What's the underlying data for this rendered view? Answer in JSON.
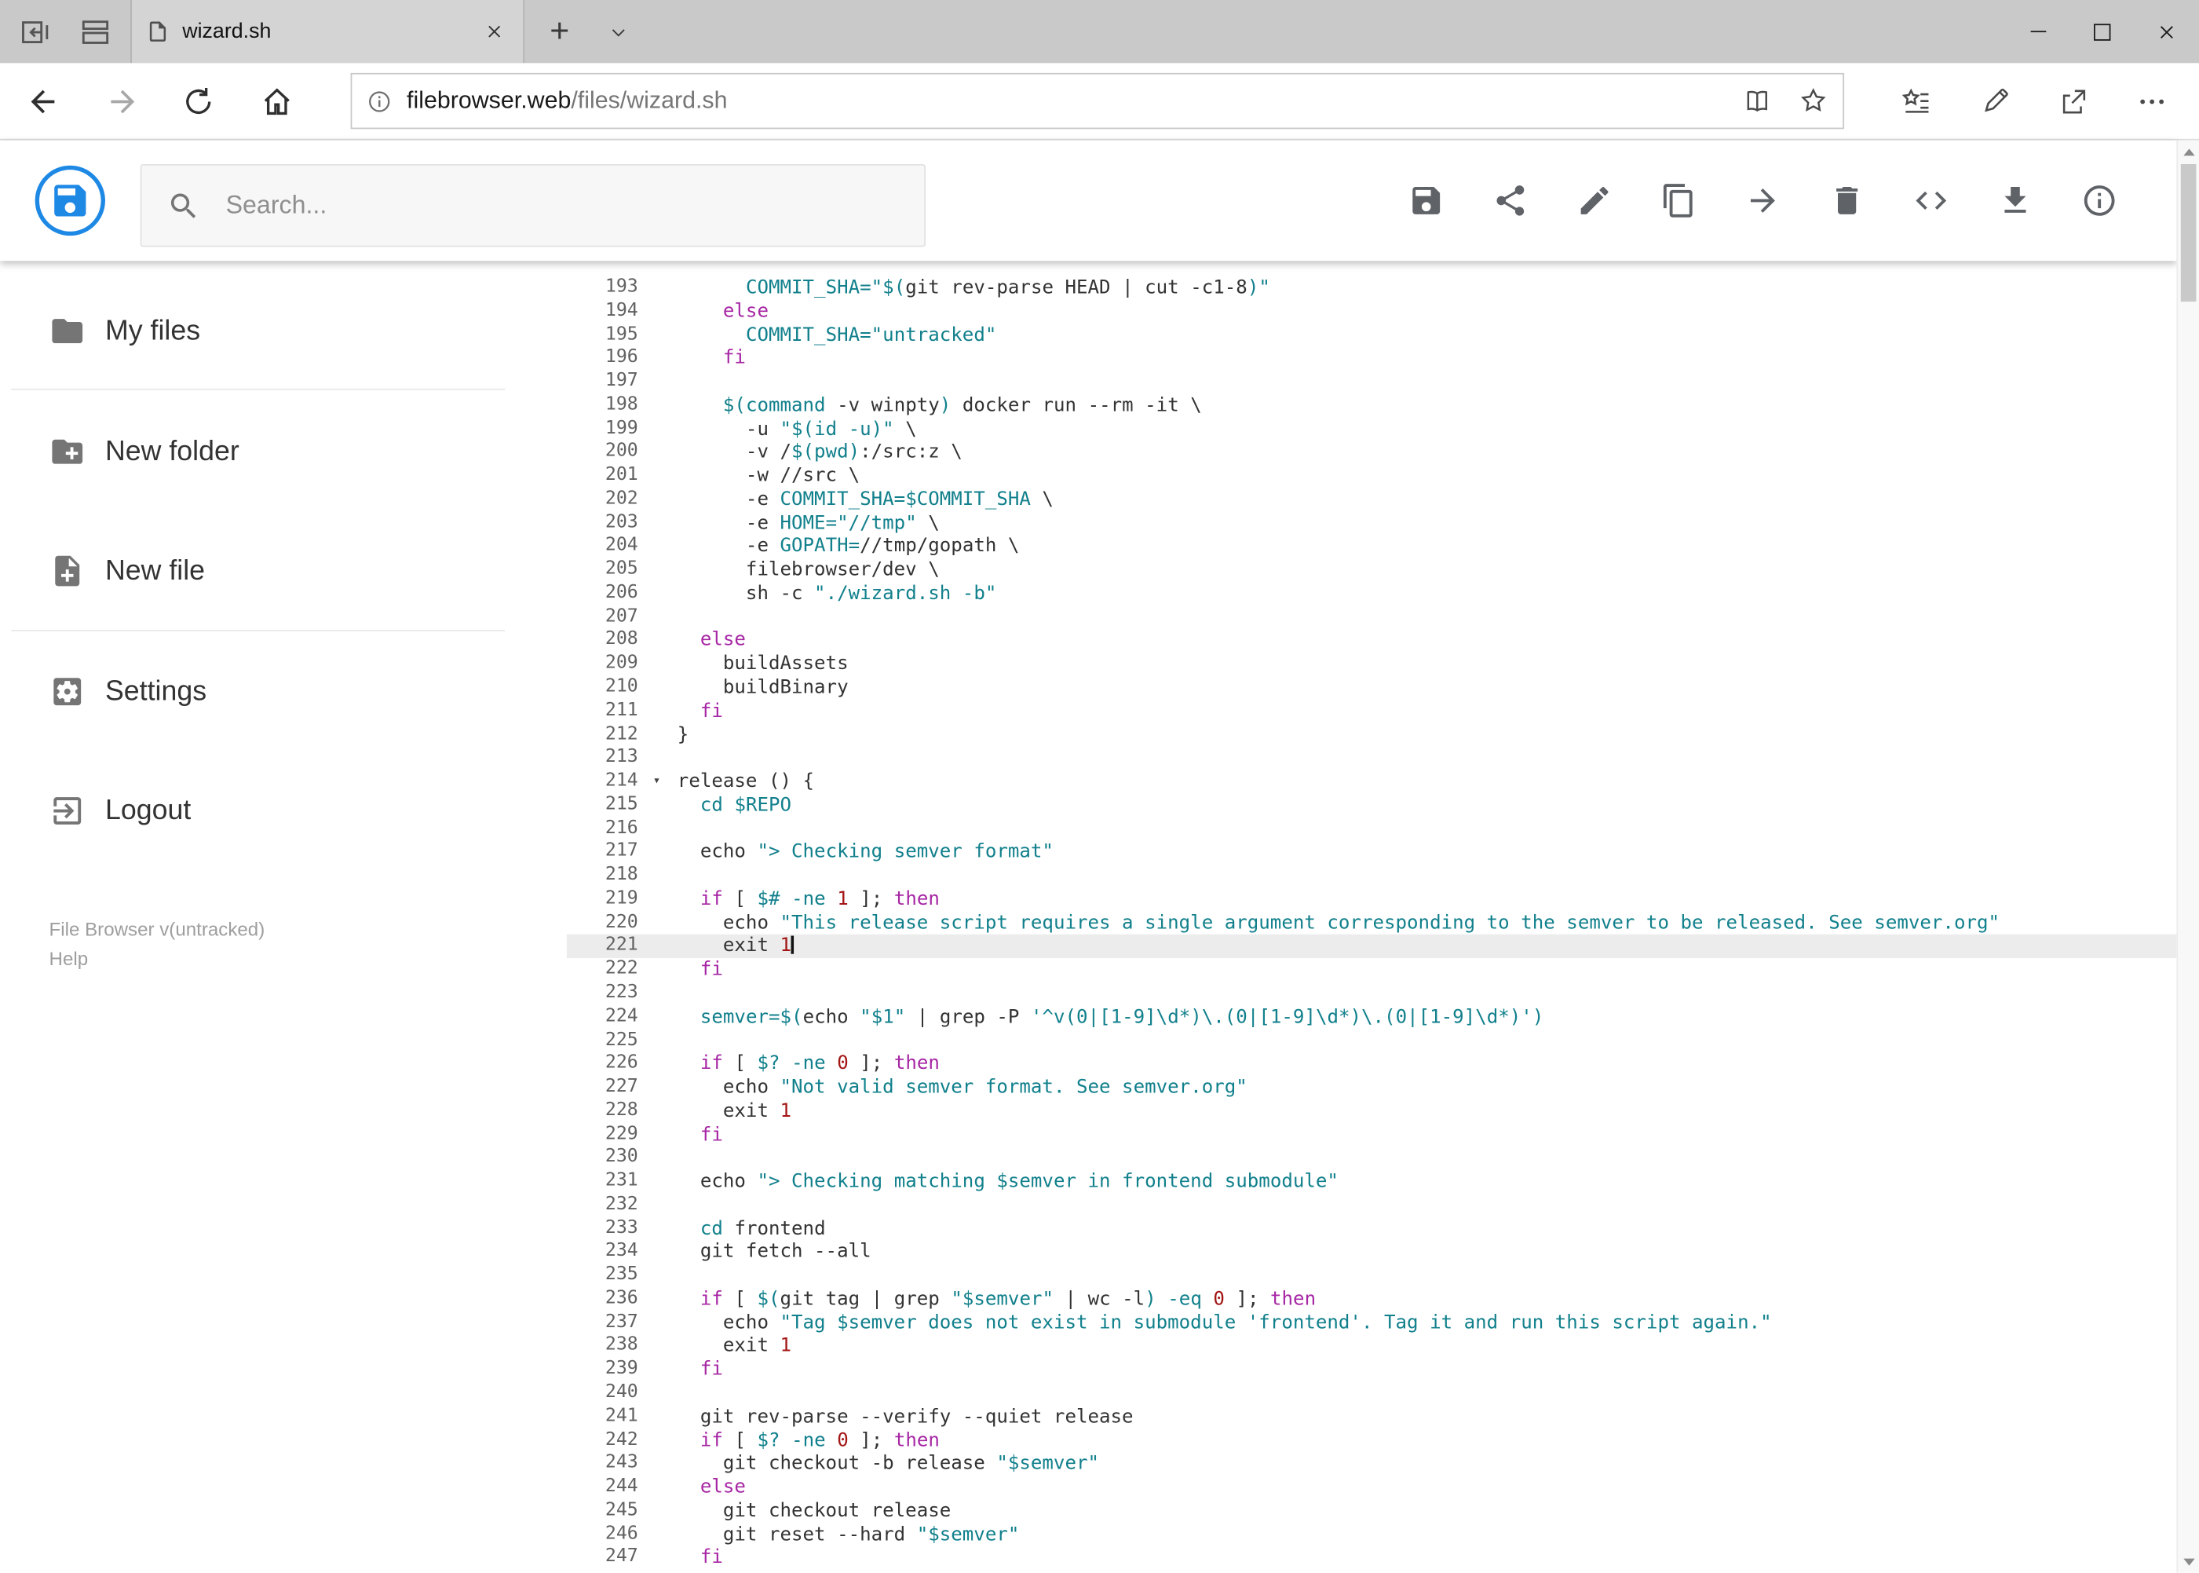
{
  "browser": {
    "tab": {
      "title": "wizard.sh"
    },
    "url": {
      "host": "filebrowser.web",
      "path": "/files/wizard.sh"
    },
    "glyphs": {
      "new_tab": "+"
    }
  },
  "header": {
    "search_placeholder": "Search...",
    "action_icons": [
      "save-icon",
      "share-icon",
      "edit-icon",
      "copy-icon",
      "move-icon",
      "delete-icon",
      "code-icon",
      "download-icon",
      "info-icon"
    ]
  },
  "sidebar": {
    "items": [
      {
        "icon": "folder-icon",
        "label": "My files"
      },
      {
        "icon": "new-folder-icon",
        "label": "New folder"
      },
      {
        "icon": "new-file-icon",
        "label": "New file"
      },
      {
        "icon": "settings-icon",
        "label": "Settings"
      },
      {
        "icon": "logout-icon",
        "label": "Logout"
      }
    ],
    "footer": {
      "version": "File Browser v(untracked)",
      "help": "Help"
    }
  },
  "colors": {
    "accent_blue": "#1E88E5",
    "icon_gray": "#5F6368",
    "keyword": "#A626A4",
    "string": "#11808C",
    "number": "#A31515",
    "plain": "#333333",
    "active_line_bg": "#ECECEC"
  },
  "editor": {
    "active_line": 221,
    "lines": [
      {
        "num": 193,
        "tokens": [
          [
            "p",
            "      "
          ],
          [
            "s",
            "COMMIT_SHA="
          ],
          [
            "s",
            "\"$("
          ],
          [
            "p",
            "git rev-parse HEAD | cut -c1-8"
          ],
          [
            "s",
            ")\""
          ]
        ]
      },
      {
        "num": 194,
        "tokens": [
          [
            "p",
            "    "
          ],
          [
            "k",
            "else"
          ]
        ]
      },
      {
        "num": 195,
        "tokens": [
          [
            "p",
            "      "
          ],
          [
            "s",
            "COMMIT_SHA="
          ],
          [
            "s",
            "\"untracked\""
          ]
        ]
      },
      {
        "num": 196,
        "tokens": [
          [
            "p",
            "    "
          ],
          [
            "k",
            "fi"
          ]
        ]
      },
      {
        "num": 197,
        "tokens": []
      },
      {
        "num": 198,
        "tokens": [
          [
            "p",
            "    "
          ],
          [
            "s",
            "$("
          ],
          [
            "s",
            "command"
          ],
          [
            "p",
            " -v winpty"
          ],
          [
            "s",
            ")"
          ],
          [
            "p",
            " docker run --rm -it \\"
          ]
        ]
      },
      {
        "num": 199,
        "tokens": [
          [
            "p",
            "      -u "
          ],
          [
            "s",
            "\"$(id -u)\""
          ],
          [
            "p",
            " \\"
          ]
        ]
      },
      {
        "num": 200,
        "tokens": [
          [
            "p",
            "      -v /"
          ],
          [
            "s",
            "$(pwd)"
          ],
          [
            "p",
            ":/src:z \\"
          ]
        ]
      },
      {
        "num": 201,
        "tokens": [
          [
            "p",
            "      -w //src \\"
          ]
        ]
      },
      {
        "num": 202,
        "tokens": [
          [
            "p",
            "      -e "
          ],
          [
            "s",
            "COMMIT_SHA=$COMMIT_SHA"
          ],
          [
            "p",
            " \\"
          ]
        ]
      },
      {
        "num": 203,
        "tokens": [
          [
            "p",
            "      -e "
          ],
          [
            "s",
            "HOME=\"//tmp\""
          ],
          [
            "p",
            " \\"
          ]
        ]
      },
      {
        "num": 204,
        "tokens": [
          [
            "p",
            "      -e "
          ],
          [
            "s",
            "GOPATH="
          ],
          [
            "p",
            "//tmp/gopath \\"
          ]
        ]
      },
      {
        "num": 205,
        "tokens": [
          [
            "p",
            "      filebrowser/dev \\"
          ]
        ]
      },
      {
        "num": 206,
        "tokens": [
          [
            "p",
            "      sh -c "
          ],
          [
            "s",
            "\"./wizard.sh -b\""
          ]
        ]
      },
      {
        "num": 207,
        "tokens": []
      },
      {
        "num": 208,
        "tokens": [
          [
            "p",
            "  "
          ],
          [
            "k",
            "else"
          ]
        ]
      },
      {
        "num": 209,
        "tokens": [
          [
            "p",
            "    buildAssets"
          ]
        ]
      },
      {
        "num": 210,
        "tokens": [
          [
            "p",
            "    buildBinary"
          ]
        ]
      },
      {
        "num": 211,
        "tokens": [
          [
            "p",
            "  "
          ],
          [
            "k",
            "fi"
          ]
        ]
      },
      {
        "num": 212,
        "tokens": [
          [
            "p",
            "}"
          ]
        ]
      },
      {
        "num": 213,
        "tokens": []
      },
      {
        "num": 214,
        "fold": true,
        "tokens": [
          [
            "p",
            "release () {"
          ]
        ]
      },
      {
        "num": 215,
        "tokens": [
          [
            "p",
            "  "
          ],
          [
            "s",
            "cd"
          ],
          [
            "p",
            " "
          ],
          [
            "s",
            "$REPO"
          ]
        ]
      },
      {
        "num": 216,
        "tokens": []
      },
      {
        "num": 217,
        "tokens": [
          [
            "p",
            "  echo "
          ],
          [
            "s",
            "\"> Checking semver format\""
          ]
        ]
      },
      {
        "num": 218,
        "tokens": []
      },
      {
        "num": 219,
        "tokens": [
          [
            "p",
            "  "
          ],
          [
            "k",
            "if"
          ],
          [
            "p",
            " [ "
          ],
          [
            "s",
            "$#"
          ],
          [
            "p",
            " "
          ],
          [
            "s",
            "-ne"
          ],
          [
            "p",
            " "
          ],
          [
            "n",
            "1"
          ],
          [
            "p",
            " ]; "
          ],
          [
            "k",
            "then"
          ]
        ]
      },
      {
        "num": 220,
        "tokens": [
          [
            "p",
            "    echo "
          ],
          [
            "s",
            "\"This release script requires a single argument corresponding to the semver to be released. See semver.org\""
          ]
        ]
      },
      {
        "num": 221,
        "tokens": [
          [
            "p",
            "    exit "
          ],
          [
            "n",
            "1"
          ]
        ]
      },
      {
        "num": 222,
        "tokens": [
          [
            "p",
            "  "
          ],
          [
            "k",
            "fi"
          ]
        ]
      },
      {
        "num": 223,
        "tokens": []
      },
      {
        "num": 224,
        "tokens": [
          [
            "p",
            "  "
          ],
          [
            "s",
            "semver="
          ],
          [
            "s",
            "$("
          ],
          [
            "p",
            "echo "
          ],
          [
            "s",
            "\"$1\""
          ],
          [
            "p",
            " | grep -P "
          ],
          [
            "s",
            "'^v(0|[1-9]\\d*)\\.(0|[1-9]\\d*)\\.(0|[1-9]\\d*)'"
          ],
          [
            "s",
            ")"
          ]
        ]
      },
      {
        "num": 225,
        "tokens": []
      },
      {
        "num": 226,
        "tokens": [
          [
            "p",
            "  "
          ],
          [
            "k",
            "if"
          ],
          [
            "p",
            " [ "
          ],
          [
            "s",
            "$?"
          ],
          [
            "p",
            " "
          ],
          [
            "s",
            "-ne"
          ],
          [
            "p",
            " "
          ],
          [
            "n",
            "0"
          ],
          [
            "p",
            " ]; "
          ],
          [
            "k",
            "then"
          ]
        ]
      },
      {
        "num": 227,
        "tokens": [
          [
            "p",
            "    echo "
          ],
          [
            "s",
            "\"Not valid semver format. See semver.org\""
          ]
        ]
      },
      {
        "num": 228,
        "tokens": [
          [
            "p",
            "    exit "
          ],
          [
            "n",
            "1"
          ]
        ]
      },
      {
        "num": 229,
        "tokens": [
          [
            "p",
            "  "
          ],
          [
            "k",
            "fi"
          ]
        ]
      },
      {
        "num": 230,
        "tokens": []
      },
      {
        "num": 231,
        "tokens": [
          [
            "p",
            "  echo "
          ],
          [
            "s",
            "\"> Checking matching $semver in frontend submodule\""
          ]
        ]
      },
      {
        "num": 232,
        "tokens": []
      },
      {
        "num": 233,
        "tokens": [
          [
            "p",
            "  "
          ],
          [
            "s",
            "cd"
          ],
          [
            "p",
            " frontend"
          ]
        ]
      },
      {
        "num": 234,
        "tokens": [
          [
            "p",
            "  git fetch --all"
          ]
        ]
      },
      {
        "num": 235,
        "tokens": []
      },
      {
        "num": 236,
        "tokens": [
          [
            "p",
            "  "
          ],
          [
            "k",
            "if"
          ],
          [
            "p",
            " [ "
          ],
          [
            "s",
            "$("
          ],
          [
            "p",
            "git tag | grep "
          ],
          [
            "s",
            "\"$semver\""
          ],
          [
            "p",
            " | wc -l"
          ],
          [
            "s",
            ")"
          ],
          [
            "p",
            " "
          ],
          [
            "s",
            "-eq"
          ],
          [
            "p",
            " "
          ],
          [
            "n",
            "0"
          ],
          [
            "p",
            " ]; "
          ],
          [
            "k",
            "then"
          ]
        ]
      },
      {
        "num": 237,
        "tokens": [
          [
            "p",
            "    echo "
          ],
          [
            "s",
            "\"Tag $semver does not exist in submodule 'frontend'. Tag it and run this script again.\""
          ]
        ]
      },
      {
        "num": 238,
        "tokens": [
          [
            "p",
            "    exit "
          ],
          [
            "n",
            "1"
          ]
        ]
      },
      {
        "num": 239,
        "tokens": [
          [
            "p",
            "  "
          ],
          [
            "k",
            "fi"
          ]
        ]
      },
      {
        "num": 240,
        "tokens": []
      },
      {
        "num": 241,
        "tokens": [
          [
            "p",
            "  git rev-parse --verify --quiet release"
          ]
        ]
      },
      {
        "num": 242,
        "tokens": [
          [
            "p",
            "  "
          ],
          [
            "k",
            "if"
          ],
          [
            "p",
            " [ "
          ],
          [
            "s",
            "$?"
          ],
          [
            "p",
            " "
          ],
          [
            "s",
            "-ne"
          ],
          [
            "p",
            " "
          ],
          [
            "n",
            "0"
          ],
          [
            "p",
            " ]; "
          ],
          [
            "k",
            "then"
          ]
        ]
      },
      {
        "num": 243,
        "tokens": [
          [
            "p",
            "    git checkout -b release "
          ],
          [
            "s",
            "\"$semver\""
          ]
        ]
      },
      {
        "num": 244,
        "tokens": [
          [
            "p",
            "  "
          ],
          [
            "k",
            "else"
          ]
        ]
      },
      {
        "num": 245,
        "tokens": [
          [
            "p",
            "    git checkout release"
          ]
        ]
      },
      {
        "num": 246,
        "tokens": [
          [
            "p",
            "    git reset --hard "
          ],
          [
            "s",
            "\"$semver\""
          ]
        ]
      },
      {
        "num": 247,
        "tokens": [
          [
            "p",
            "  "
          ],
          [
            "k",
            "fi"
          ]
        ]
      }
    ]
  }
}
